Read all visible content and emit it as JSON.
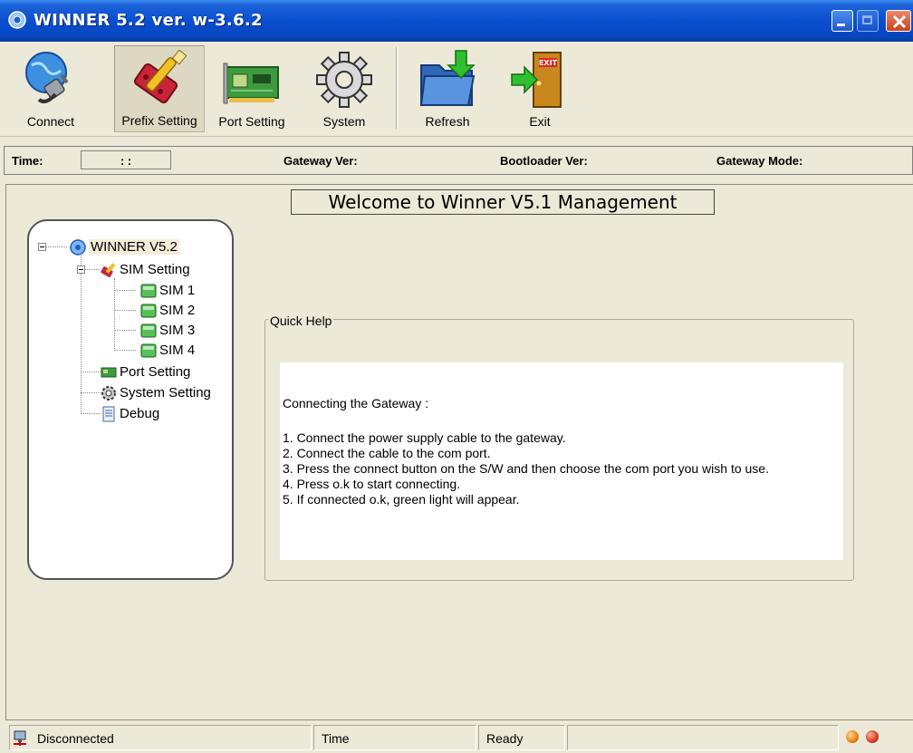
{
  "window": {
    "title": "WINNER 5.2 ver. w-3.6.2"
  },
  "toolbar": {
    "buttons": [
      {
        "label": "Connect",
        "icon": "connect-plug-globe-icon"
      },
      {
        "label": "Prefix Setting",
        "icon": "prefix-setting-tools-icon",
        "active": true
      },
      {
        "label": "Port Setting",
        "icon": "port-setting-card-icon"
      },
      {
        "label": "System",
        "icon": "system-gear-icon"
      },
      {
        "label": "Refresh",
        "icon": "refresh-folder-icon"
      },
      {
        "label": "Exit",
        "icon": "exit-door-icon"
      }
    ]
  },
  "infobar": {
    "time_label": "Time:",
    "time_value": ":   :",
    "gateway_ver_label": "Gateway Ver:",
    "bootloader_ver_label": "Bootloader Ver:",
    "gateway_mode_label": "Gateway Mode:"
  },
  "welcome": "Welcome to  Winner V5.1 Management",
  "tree": {
    "root": "WINNER V5.2",
    "sim_setting": "SIM Setting",
    "sims": [
      "SIM 1",
      "SIM 2",
      "SIM 3",
      "SIM 4"
    ],
    "port_setting": "Port Setting",
    "system_setting": "System Setting",
    "debug": "Debug"
  },
  "quick_help": {
    "legend": "Quick Help",
    "heading": "Connecting the Gateway :",
    "steps": [
      "1. Connect the power supply cable to the gateway.",
      "2. Connect the cable to the com port.",
      "3. Press the connect button on the S/W and then choose the com port you wish to use.",
      "4. Press o.k to start connecting.",
      "5. If connected o.k, green light will appear."
    ]
  },
  "statusbar": {
    "connection": "Disconnected",
    "time": "Time",
    "state": "Ready",
    "extra": ""
  },
  "colors": {
    "titlebar": "#0a4fcf",
    "face": "#ece9d8",
    "led": "#e8821a"
  }
}
